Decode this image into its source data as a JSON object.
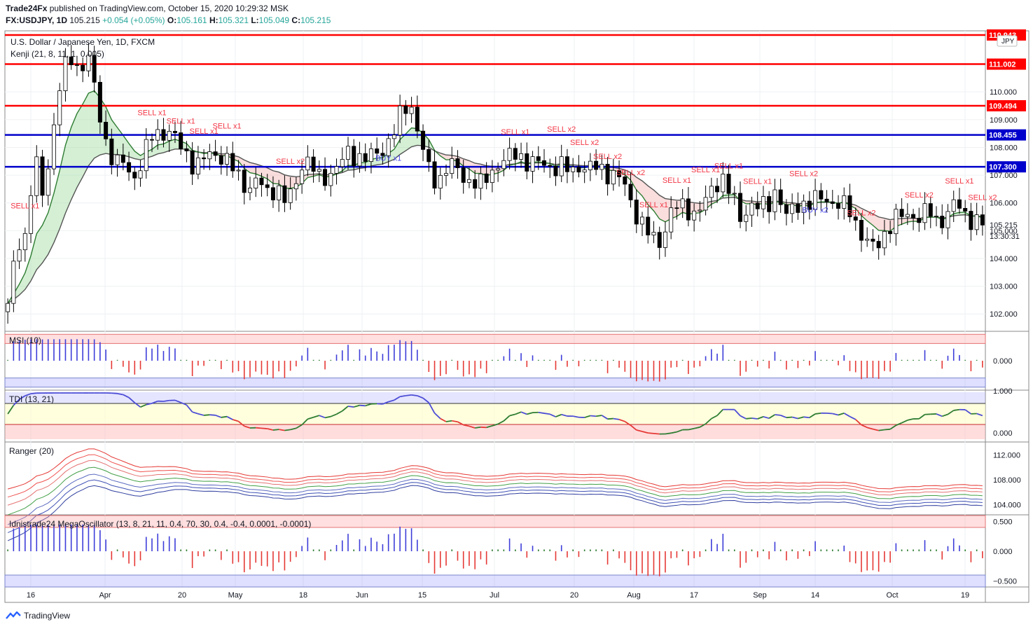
{
  "header": {
    "publisher": "Trade24Fx",
    "published_text": "published on TradingView.com, October 15, 2020 10:29:32 MSK",
    "symbol": "FX:USDJPY, 1D",
    "last": "105.215",
    "change": "+0.054 (+0.05%)",
    "o_label": "O:",
    "o": "105.161",
    "h_label": "H:",
    "h": "105.321",
    "l_label": "L:",
    "l": "105.049",
    "c_label": "C:",
    "c": "105.215"
  },
  "main_pane": {
    "title": "U.S. Dollar / Japanese Yen, 1D, FXCM",
    "indicator": "Kenji (21, 8, 11, 1, 0.005)",
    "currency_badge": "JPY",
    "price_label": "105.215",
    "countdown": "13:30:31"
  },
  "footer": {
    "brand": "TradingView"
  },
  "colors": {
    "up": "#ffffff",
    "down": "#000000",
    "red_line": "#ff0000",
    "blue_line": "#0000cc",
    "sell": "#f23645",
    "buy": "#4a4ae8",
    "ma_green": "#2e7d32",
    "ma_dark": "#555555"
  },
  "chart_data": [
    {
      "type": "candlestick",
      "title": "U.S. Dollar / Japanese Yen, 1D, FXCM",
      "ylim": [
        101.4,
        112.2
      ],
      "y_ticks": [
        102.0,
        103.0,
        104.0,
        105.0,
        106.0,
        107.0,
        108.0,
        109.0,
        110.0
      ],
      "y_tick_labels": [
        "102.000",
        "103.000",
        "104.000",
        "105.000",
        "106.000",
        "107.000",
        "108.000",
        "109.000",
        "110.000"
      ],
      "x_labels": [
        "16",
        "Apr",
        "20",
        "May",
        "18",
        "Jun",
        "15",
        "Jul",
        "20",
        "Aug",
        "17",
        "Sep",
        "14",
        "Oct",
        "19"
      ],
      "close_path": [
        102.2,
        104.6,
        104.8,
        107.6,
        106.2,
        108.5,
        110.5,
        111.3,
        110.8,
        111.2,
        109.6,
        108.2,
        107.3,
        107.5,
        106.9,
        107.4,
        108.4,
        108.6,
        108.5,
        108.2,
        107.8,
        107.2,
        107.6,
        107.9,
        107.6,
        107.3,
        106.9,
        106.5,
        106.8,
        106.4,
        106.6,
        106.0,
        106.5,
        107.6,
        107.3,
        106.8,
        107.1,
        107.3,
        107.8,
        107.7,
        107.6,
        107.7,
        108.0,
        108.4,
        109.2,
        109.7,
        108.4,
        107.2,
        106.7,
        107.3,
        107.3,
        106.9,
        106.8,
        106.6,
        107.1,
        107.5,
        107.6,
        107.8,
        107.5,
        107.4,
        107.4,
        107.3,
        107.3,
        107.1,
        107.4,
        107.2,
        107.3,
        107.1,
        107.0,
        106.6,
        105.8,
        105.2,
        104.7,
        104.6,
        105.6,
        105.9,
        105.8,
        105.6,
        106.0,
        106.7,
        106.9,
        106.2,
        105.4,
        106.0,
        105.8,
        105.9,
        106.6,
        105.4,
        105.9,
        106.0,
        106.0,
        106.2,
        106.1,
        105.9,
        105.8,
        105.2,
        104.6,
        104.3,
        104.9,
        105.4,
        105.5,
        105.6,
        105.5,
        105.7,
        105.3,
        105.6,
        106.0,
        105.6,
        105.4,
        105.2
      ],
      "levels": [
        {
          "label": "110.943",
          "value": 112.05,
          "color": "#ff0000"
        },
        {
          "label": "111.002",
          "value": 111.0,
          "color": "#ff0000"
        },
        {
          "label": "109.494",
          "value": 109.5,
          "color": "#ff0000"
        },
        {
          "label": "108.455",
          "value": 108.45,
          "color": "#0000cc"
        },
        {
          "label": "107.300",
          "value": 107.3,
          "color": "#0000cc"
        }
      ],
      "annotations": [
        {
          "text": "SELL x1",
          "i": 3
        },
        {
          "text": "SELL x1",
          "i": 25
        },
        {
          "text": "SELL x1",
          "i": 30
        },
        {
          "text": "SELL x1",
          "i": 34
        },
        {
          "text": "SELL x1",
          "i": 38
        },
        {
          "text": "SELL x2",
          "i": 49
        },
        {
          "text": "BUY x1",
          "i": 66
        },
        {
          "text": "SELL x1",
          "i": 88
        },
        {
          "text": "SELL x2",
          "i": 96
        },
        {
          "text": "SELL x2",
          "i": 100
        },
        {
          "text": "SELL x2",
          "i": 104
        },
        {
          "text": "SELL x2",
          "i": 108
        },
        {
          "text": "SELL x1",
          "i": 112
        },
        {
          "text": "SELL x1",
          "i": 116
        },
        {
          "text": "SELL x1",
          "i": 121
        },
        {
          "text": "SELL x1",
          "i": 125
        },
        {
          "text": "SELL x1",
          "i": 130
        },
        {
          "text": "SELL x2",
          "i": 138
        },
        {
          "text": "BUY x2",
          "i": 140
        },
        {
          "text": "SELL x2",
          "i": 148
        },
        {
          "text": "SELL x2",
          "i": 158
        },
        {
          "text": "SELL x1",
          "i": 165
        },
        {
          "text": "SELL x2",
          "i": 170
        }
      ]
    },
    {
      "type": "bar",
      "title": "MSI (10)",
      "ylim": [
        -1,
        1
      ],
      "y_tick_labels": [
        "0.000"
      ]
    },
    {
      "type": "line",
      "title": "TDI (13, 21)",
      "ylim": [
        -0.2,
        1.0
      ],
      "y_tick_labels": [
        "1.000",
        "0.000"
      ]
    },
    {
      "type": "line",
      "title": "Ranger (20)",
      "ylim": [
        102.5,
        114.0
      ],
      "y_tick_labels": [
        "112.000",
        "108.000",
        "104.000"
      ]
    },
    {
      "type": "bar",
      "title": "Idnistrade24 MegaOscillator (13, 8, 21, 11, 0.4, 70, 30, 0.4, -0.4, 0.0001, -0.0001)",
      "ylim": [
        -0.6,
        0.6
      ],
      "y_tick_labels": [
        "0.500",
        "0.000",
        "−0.500"
      ]
    }
  ]
}
